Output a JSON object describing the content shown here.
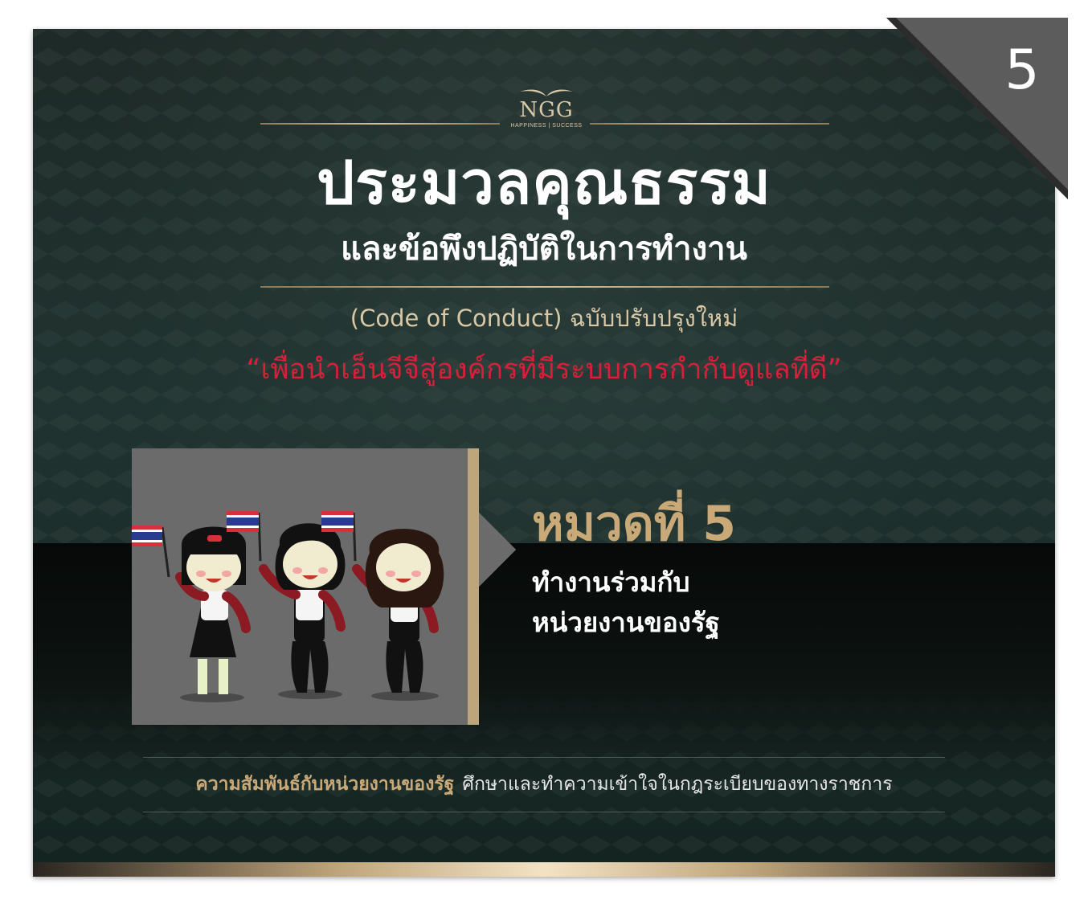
{
  "page_number": "5",
  "logo": {
    "name": "NGG",
    "tagline": "HAPPINESS | SUCCESS"
  },
  "title": {
    "line1": "ประมวลคุณธรรม",
    "line2": "และข้อพึงปฏิบัติในการทำงาน"
  },
  "subtitle": "(Code of Conduct) ฉบับปรับปรุงใหม่",
  "slogan": "“เพื่อนำเอ็นจีจีสู่องค์กรที่มีระบบการกำกับดูแลที่ดี”",
  "chapter": {
    "heading": "หมวดที่ 5",
    "line1": "ทำงานร่วมกับ",
    "line2": "หน่วยงานของรัฐ"
  },
  "footer": {
    "highlight": "ความสัมพันธ์กับหน่วยงานของรัฐ",
    "text": "ศึกษาและทำความเข้าใจในกฎระเบียบของทางราชการ"
  },
  "colors": {
    "background": "#1e2a27",
    "gold": "#c9a978",
    "slogan_red": "#d81f3a",
    "panel_gray": "#6b6b6b"
  }
}
